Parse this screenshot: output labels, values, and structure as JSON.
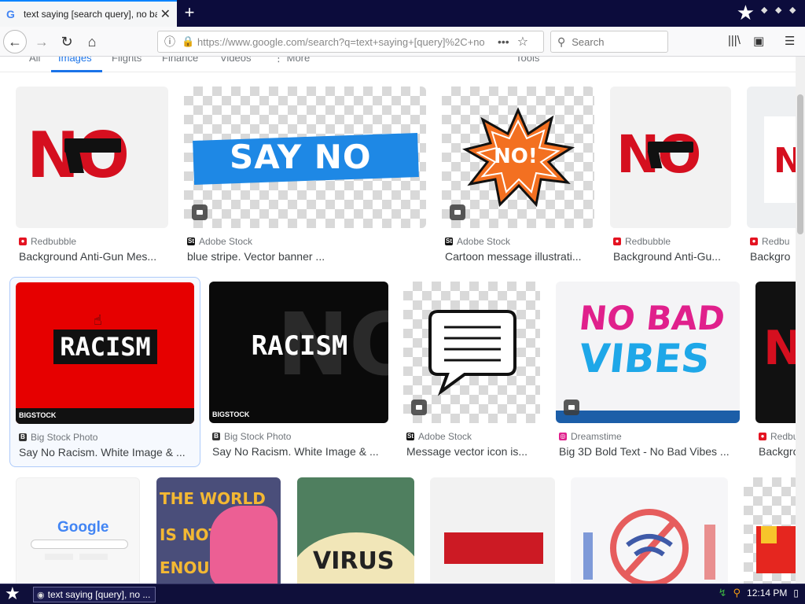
{
  "browser": {
    "tab_title": "text saying [search query], no background - G",
    "tab_close": "✕",
    "new_tab": "+",
    "url": "https://www.google.com/search?q=text+saying+[query]%2C+no",
    "search_placeholder": "Search",
    "page_actions": "•••"
  },
  "google_tabs": {
    "all": "All",
    "images": "Images",
    "flights": "Flights",
    "finance": "Finance",
    "videos": "Videos",
    "more": "⋮ More",
    "tools": "Tools"
  },
  "row1": [
    {
      "source": "Redbubble",
      "caption": "Background Anti-Gun Mes..."
    },
    {
      "source": "Adobe Stock",
      "caption": "blue stripe. Vector banner ..."
    },
    {
      "source": "Adobe Stock",
      "caption": "Cartoon message illustrati..."
    },
    {
      "source": "Redbubble",
      "caption": "Background Anti-Gu..."
    },
    {
      "source": "Redbu",
      "caption": "Backgro"
    }
  ],
  "row2": [
    {
      "source": "Big Stock Photo",
      "caption": "Say No Racism. White Image & ..."
    },
    {
      "source": "Big Stock Photo",
      "caption": "Say No Racism. White Image & ..."
    },
    {
      "source": "Adobe Stock",
      "caption": "Message vector icon is..."
    },
    {
      "source": "Dreamstime",
      "caption": "Big 3D Bold Text - No Bad Vibes ..."
    },
    {
      "source": "Redbu",
      "caption": "Backgro"
    }
  ],
  "thumb_text": {
    "no": "NO",
    "say_no": "SAY NO",
    "no_excl": "NO!",
    "racism": "RACISM",
    "no_bad": "NO BAD",
    "vibes": "VIBES",
    "bigstock": "BIGSTOCK",
    "google": "Google",
    "the_world": "THE WORLD",
    "is_not": "IS NOT",
    "enough": "ENOUGH",
    "virus": "VIRUS"
  },
  "taskbar": {
    "task_label": "text saying [query], no ...",
    "clock": "12:14 PM"
  },
  "colors": {
    "accent": "#1a73e8",
    "red": "#e00000",
    "blue_banner": "#1e88e5"
  }
}
